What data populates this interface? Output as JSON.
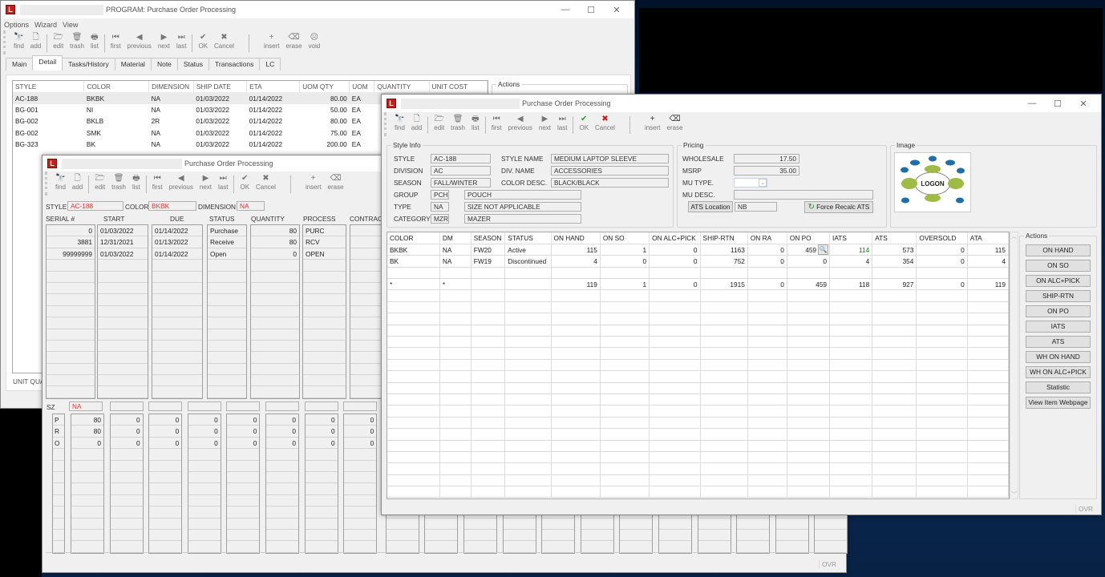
{
  "back_window": {
    "title": "PROGRAM: Purchase Order Processing",
    "menu": [
      "Options",
      "Wizard",
      "View"
    ],
    "toolbar": [
      {
        "icon": "binoculars-icon",
        "glyph": "🔭",
        "label": "find"
      },
      {
        "icon": "new-document-icon",
        "glyph": "🗋",
        "label": "add"
      },
      {
        "icon": "open-folder-icon",
        "glyph": "🗁",
        "label": "edit"
      },
      {
        "icon": "trash-icon",
        "glyph": "🗑",
        "label": "trash"
      },
      {
        "icon": "printer-icon",
        "glyph": "🖶",
        "label": "list"
      },
      {
        "icon": "first-icon",
        "glyph": "⏮",
        "label": "first"
      },
      {
        "icon": "previous-icon",
        "glyph": "◀",
        "label": "previous"
      },
      {
        "icon": "next-icon",
        "glyph": "▶",
        "label": "next"
      },
      {
        "icon": "last-icon",
        "glyph": "⏭",
        "label": "last"
      },
      {
        "icon": "check-icon",
        "glyph": "✔",
        "label": "OK"
      },
      {
        "icon": "cancel-x-icon",
        "glyph": "✖",
        "label": "Cancel"
      },
      {
        "icon": "plus-icon",
        "glyph": "+",
        "label": "insert"
      },
      {
        "icon": "eraser-icon",
        "glyph": "⌫",
        "label": "erase"
      },
      {
        "icon": "sad-face-icon",
        "glyph": "☹",
        "label": "void"
      }
    ],
    "tabs": [
      "Main",
      "Detail",
      "Tasks/History",
      "Material",
      "Note",
      "Status",
      "Transactions",
      "LC"
    ],
    "active_tab": "Detail",
    "grid_headers": [
      "STYLE",
      "COLOR",
      "DIMENSION",
      "SHIP DATE",
      "ETA",
      "UOM QTY",
      "UOM",
      "QUANTITY",
      "UNIT COST"
    ],
    "grid_rows": [
      [
        "AC-188",
        "BKBK",
        "NA",
        "01/03/2022",
        "01/14/2022",
        "80.00",
        "EA"
      ],
      [
        "BG-001",
        "NI",
        "NA",
        "01/03/2022",
        "01/14/2022",
        "50.00",
        "EA"
      ],
      [
        "BG-002",
        "BKLB",
        "2R",
        "01/03/2022",
        "01/14/2022",
        "80.00",
        "EA"
      ],
      [
        "BG-002",
        "SMK",
        "NA",
        "01/03/2022",
        "01/14/2022",
        "75.00",
        "EA"
      ],
      [
        "BG-323",
        "BK",
        "NA",
        "01/03/2022",
        "01/14/2022",
        "200.00",
        "EA"
      ]
    ],
    "actions_label": "Actions",
    "unit_qty_label": "UNIT QUA"
  },
  "mid_window": {
    "title": "Purchase Order Processing",
    "toolbar": [
      {
        "icon": "binoculars-icon",
        "glyph": "🔭",
        "label": "find"
      },
      {
        "icon": "new-document-icon",
        "glyph": "🗋",
        "label": "add"
      },
      {
        "icon": "open-folder-icon",
        "glyph": "🗁",
        "label": "edit"
      },
      {
        "icon": "trash-icon",
        "glyph": "🗑",
        "label": "trash"
      },
      {
        "icon": "printer-icon",
        "glyph": "🖶",
        "label": "list"
      },
      {
        "icon": "first-icon",
        "glyph": "⏮",
        "label": "first"
      },
      {
        "icon": "previous-icon",
        "glyph": "◀",
        "label": "previous"
      },
      {
        "icon": "next-icon",
        "glyph": "▶",
        "label": "next"
      },
      {
        "icon": "last-icon",
        "glyph": "⏭",
        "label": "last"
      },
      {
        "icon": "check-icon",
        "glyph": "✔",
        "label": "OK"
      },
      {
        "icon": "cancel-x-icon",
        "glyph": "✖",
        "label": "Cancel"
      },
      {
        "icon": "plus-icon",
        "glyph": "+",
        "label": "insert"
      },
      {
        "icon": "eraser-icon",
        "glyph": "⌫",
        "label": "erase"
      }
    ],
    "style_label": "STYLE",
    "style_value": "AC-188",
    "color_label": "COLOR",
    "color_value": "BKBK",
    "dimension_label": "DIMENSION",
    "dimension_value": "NA",
    "columns": [
      "SERIAL #",
      "START",
      "DUE",
      "STATUS",
      "QUANTITY",
      "PROCESS",
      "CONTRACT"
    ],
    "rows": [
      [
        "0",
        "01/03/2022",
        "01/14/2022",
        "Purchase",
        "80",
        "PURC"
      ],
      [
        "3881",
        "12/31/2021",
        "01/13/2022",
        "Receive",
        "80",
        "RCV"
      ],
      [
        "99999999",
        "01/03/2022",
        "01/14/2022",
        "Open",
        "0",
        "OPEN"
      ]
    ],
    "sz_label": "SZ",
    "sz_value": "NA",
    "size_rows": [
      {
        "code": "P",
        "values": [
          "80",
          "0",
          "0",
          "0",
          "0",
          "0",
          "0",
          "0"
        ]
      },
      {
        "code": "R",
        "values": [
          "80",
          "0",
          "0",
          "0",
          "0",
          "0",
          "0",
          "0"
        ]
      },
      {
        "code": "O",
        "values": [
          "0",
          "0",
          "0",
          "0",
          "0",
          "0",
          "0",
          "0"
        ]
      }
    ],
    "status_ovr": "OVR"
  },
  "front_window": {
    "title": "Purchase Order Processing",
    "toolbar": [
      {
        "icon": "binoculars-icon",
        "glyph": "🔭",
        "label": "find"
      },
      {
        "icon": "new-document-icon",
        "glyph": "🗋",
        "label": "add"
      },
      {
        "icon": "open-folder-icon",
        "glyph": "🗁",
        "label": "edit"
      },
      {
        "icon": "trash-icon",
        "glyph": "🗑",
        "label": "trash"
      },
      {
        "icon": "printer-icon",
        "glyph": "🖶",
        "label": "list"
      },
      {
        "icon": "first-icon",
        "glyph": "⏮",
        "label": "first"
      },
      {
        "icon": "previous-icon",
        "glyph": "◀",
        "label": "previous"
      },
      {
        "icon": "next-icon",
        "glyph": "▶",
        "label": "next"
      },
      {
        "icon": "last-icon",
        "glyph": "⏭",
        "label": "last"
      },
      {
        "icon": "check-icon",
        "glyph": "✔",
        "label": "OK"
      },
      {
        "icon": "cancel-x-icon",
        "glyph": "✖",
        "label": "Cancel"
      },
      {
        "icon": "plus-icon",
        "glyph": "+",
        "label": "insert"
      },
      {
        "icon": "eraser-icon",
        "glyph": "⌫",
        "label": "erase"
      }
    ],
    "style_info": {
      "label": "Style Info",
      "style": {
        "label": "STYLE",
        "value": "AC-188"
      },
      "division": {
        "label": "DIVISION",
        "value": "AC"
      },
      "season": {
        "label": "SEASON",
        "value": "FALL/WINTER"
      },
      "group": {
        "label": "GROUP",
        "code": "PCH",
        "desc": "POUCH"
      },
      "type": {
        "label": "TYPE",
        "code": "NA",
        "desc": "SIZE NOT APPLICABLE"
      },
      "category": {
        "label": "CATEGORY",
        "code": "MZR",
        "desc": "MAZER"
      },
      "style_name": {
        "label": "STYLE NAME",
        "value": "MEDIUM LAPTOP SLEEVE"
      },
      "div_name": {
        "label": "DIV. NAME",
        "value": "ACCESSORIES"
      },
      "color_desc": {
        "label": "COLOR DESC.",
        "value": "BLACK/BLACK"
      }
    },
    "pricing": {
      "label": "Pricing",
      "wholesale": {
        "label": "WHOLESALE",
        "value": "17.50"
      },
      "msrp": {
        "label": "MSRP",
        "value": "35.00"
      },
      "mu_type": {
        "label": "MU TYPE.",
        "value": ""
      },
      "mu_desc": {
        "label": "MU DESC.",
        "value": ""
      },
      "ats_location_button": "ATS Location",
      "ats_location_value": "NB",
      "force_recalc_button": "Force Recalc ATS"
    },
    "image_label": "Image",
    "logo_text": "LOGON",
    "grid_headers": [
      "COLOR",
      "DM",
      "SEASON",
      "STATUS",
      "ON HAND",
      "ON SO",
      "ON ALC+PICK",
      "SHIP-RTN",
      "ON RA",
      "ON PO",
      "IATS",
      "ATS",
      "OVERSOLD",
      "ATA"
    ],
    "grid_rows": [
      [
        "BKBK",
        "NA",
        "FW20",
        "Active",
        "115",
        "1",
        "0",
        "1163",
        "0",
        "459",
        "114",
        "573",
        "0",
        "115"
      ],
      [
        "BK",
        "NA",
        "FW19",
        "Discontinued",
        "4",
        "0",
        "0",
        "752",
        "0",
        "0",
        "4",
        "354",
        "0",
        "4"
      ],
      [
        "",
        "",
        "",
        "",
        "",
        "",
        "",
        "",
        "",
        "",
        "",
        "",
        "",
        ""
      ],
      [
        "*",
        "*",
        "",
        "",
        "119",
        "1",
        "0",
        "1915",
        "0",
        "459",
        "118",
        "927",
        "0",
        "119"
      ]
    ],
    "actions_label": "Actions",
    "actions": [
      "ON HAND",
      "ON SO",
      "ON ALC+PICK",
      "SHIP-RTN",
      "ON PO",
      "IATS",
      "ATS",
      "WH ON HAND",
      "WH ON ALC+PICK",
      "Statistic",
      "View Item Webpage"
    ],
    "status_ovr": "OVR"
  }
}
